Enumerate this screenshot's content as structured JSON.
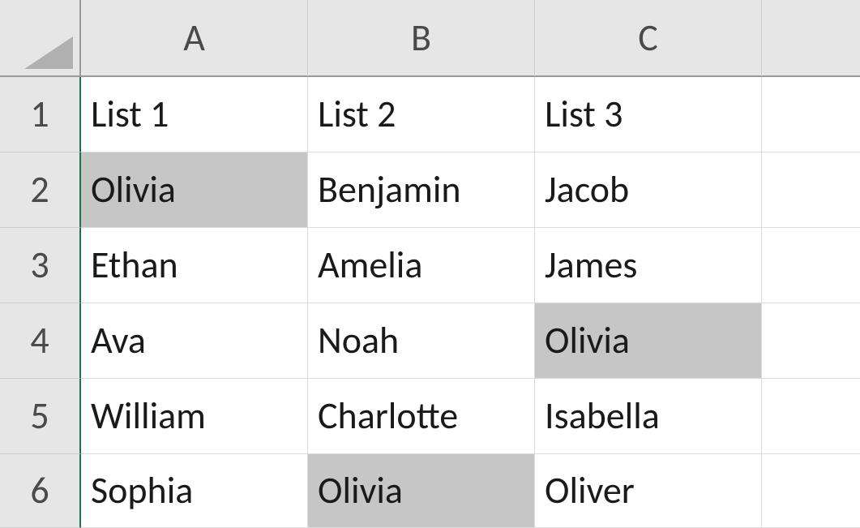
{
  "chart_data": {
    "type": "table",
    "columns": [
      "A",
      "B",
      "C"
    ],
    "rows": [
      "1",
      "2",
      "3",
      "4",
      "5",
      "6"
    ],
    "cells": {
      "A1": {
        "value": "List 1",
        "highlighted": false
      },
      "B1": {
        "value": "List 2",
        "highlighted": false
      },
      "C1": {
        "value": "List 3",
        "highlighted": false
      },
      "A2": {
        "value": "Olivia",
        "highlighted": true
      },
      "B2": {
        "value": "Benjamin",
        "highlighted": false
      },
      "C2": {
        "value": "Jacob",
        "highlighted": false
      },
      "A3": {
        "value": "Ethan",
        "highlighted": false
      },
      "B3": {
        "value": "Amelia",
        "highlighted": false
      },
      "C3": {
        "value": "James",
        "highlighted": false
      },
      "A4": {
        "value": "Ava",
        "highlighted": false
      },
      "B4": {
        "value": "Noah",
        "highlighted": false
      },
      "C4": {
        "value": "Olivia",
        "highlighted": true
      },
      "A5": {
        "value": "William",
        "highlighted": false
      },
      "B5": {
        "value": "Charlotte",
        "highlighted": false
      },
      "C5": {
        "value": "Isabella",
        "highlighted": false
      },
      "A6": {
        "value": "Sophia",
        "highlighted": false
      },
      "B6": {
        "value": "Olivia",
        "highlighted": true
      },
      "C6": {
        "value": "Oliver",
        "highlighted": false
      }
    }
  }
}
